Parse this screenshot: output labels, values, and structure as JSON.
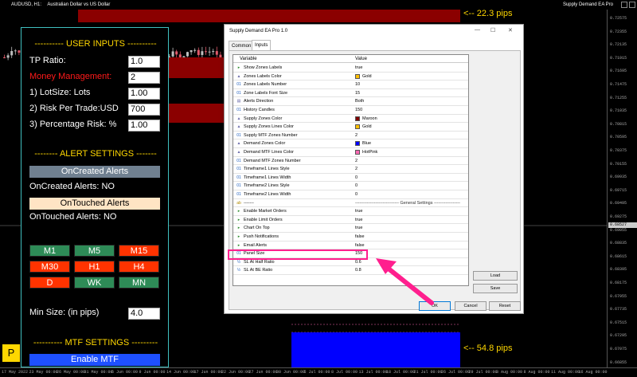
{
  "chart": {
    "symbol_text": "AUDUSD, H1:",
    "description": "Australian Dollar vs US Dollar",
    "ea_title": "Supply Demand EA Pro",
    "price_ticks": [
      "0.72575",
      "0.72355",
      "0.72135",
      "0.71915",
      "0.71695",
      "0.71475",
      "0.71255",
      "0.71035",
      "0.70815",
      "0.70595",
      "0.70375",
      "0.70155",
      "0.69935",
      "0.69715",
      "0.69495",
      "0.69275",
      "0.69055",
      "0.68835",
      "0.68615",
      "0.68395",
      "0.68175",
      "0.67955",
      "0.67735",
      "0.67515",
      "0.67295",
      "0.67075",
      "0.66855"
    ],
    "current_price": "0.68527",
    "time_ticks": [
      "17 May 2022",
      "23 May 00:00",
      "26 May 00:00",
      "31 May 00:00",
      "6 Jun 00:00",
      "9 Jun 00:00",
      "14 Jun 00:00",
      "17 Jun 00:00",
      "22 Jun 00:00",
      "27 Jun 00:00",
      "30 Jun 00:00",
      "5 Jul 00:00",
      "8 Jul 00:00",
      "13 Jul 00:00",
      "18 Jul 00:00",
      "21 Jul 00:00",
      "26 Jul 00:00",
      "29 Jul 00:00",
      "3 Aug 00:00",
      "8 Aug 00:00",
      "11 Aug 00:00",
      "16 Aug 00:00"
    ],
    "supply_pips": "<-- 22.3 pips",
    "demand_pips": "<-- 54.8 pips",
    "colors": {
      "supply": "#8b0000",
      "demand": "#0000ff",
      "bull": "#bfbfbf",
      "bear": "#e05a6a"
    }
  },
  "panel": {
    "user_inputs_title": "---------- USER INPUTS ----------",
    "tp_ratio_label": "TP Ratio:",
    "tp_ratio_value": "1.0",
    "money_mgmt_label": "Money Management:",
    "money_mgmt_value": "2",
    "lotsize_label": "1) LotSize: Lots",
    "lotsize_value": "1.00",
    "risk_label": "2) Risk Per Trade:USD",
    "risk_value": "700",
    "pct_label": "3) Percentage Risk: %",
    "pct_value": "1.00",
    "alert_title": "-------- ALERT SETTINGS -------",
    "oncreated_button": "OnCreated Alerts",
    "oncreated_status": "OnCreated Alerts: NO",
    "ontouched_button": "OnTouched Alerts",
    "ontouched_status": "OnTouched Alerts: NO",
    "timeframes": [
      {
        "label": "M1",
        "color": "green"
      },
      {
        "label": "M5",
        "color": "green"
      },
      {
        "label": "M15",
        "color": "red"
      },
      {
        "label": "M30",
        "color": "red"
      },
      {
        "label": "H1",
        "color": "red"
      },
      {
        "label": "H4",
        "color": "red"
      },
      {
        "label": "D",
        "color": "red"
      },
      {
        "label": "WK",
        "color": "green"
      },
      {
        "label": "MN",
        "color": "green"
      }
    ],
    "min_size_label": "Min Size: (in pips)",
    "min_size_value": "4.0",
    "mtf_title": "---------- MTF SETTINGS ---------",
    "enable_mtf_button": "Enable MTF",
    "p_button": "P"
  },
  "dialog": {
    "title": "Supply Demand EA Pro 1.0",
    "tabs": [
      "Common",
      "Inputs"
    ],
    "col_variable": "Variable",
    "col_value": "Value",
    "rows": [
      {
        "icon": "flag",
        "var": "Show Zones Labels",
        "val": "true"
      },
      {
        "icon": "color",
        "var": "Zones Labels Color",
        "val": "Gold",
        "swatch": "#ffc000"
      },
      {
        "icon": "int",
        "var": "Zones Labels Number",
        "val": "10"
      },
      {
        "icon": "int",
        "var": "Zone Labels Font Size",
        "val": "15"
      },
      {
        "icon": "enum",
        "var": "Alerts Direction",
        "val": "Both"
      },
      {
        "icon": "int",
        "var": "History Candles",
        "val": "150"
      },
      {
        "icon": "color",
        "var": "Supply Zones Color",
        "val": "Maroon",
        "swatch": "#800000"
      },
      {
        "icon": "color",
        "var": "Supply Zones Lines Color",
        "val": "Gold",
        "swatch": "#ffc000"
      },
      {
        "icon": "int",
        "var": "Supply MTF Zones Number",
        "val": "2"
      },
      {
        "icon": "color",
        "var": "Demand Zones Color",
        "val": "Blue",
        "swatch": "#0000ff"
      },
      {
        "icon": "color",
        "var": "Demand MTF Lines Color",
        "val": "HotPink",
        "swatch": "#ff69b4"
      },
      {
        "icon": "int",
        "var": "Demand MTF Zones Number",
        "val": "2"
      },
      {
        "icon": "int",
        "var": "Timeframe1 Lines Style",
        "val": "2"
      },
      {
        "icon": "int",
        "var": "Timeframe1 Lines Width",
        "val": "0"
      },
      {
        "icon": "int",
        "var": "Timeframe2 Lines Style",
        "val": "0"
      },
      {
        "icon": "int",
        "var": "Timeframe2 Lines Width",
        "val": "0"
      },
      {
        "icon": "str",
        "var": "-------",
        "val": "------------------------------ General Settings ------------------",
        "sep": true
      },
      {
        "icon": "flag",
        "var": "Enable Market Orders",
        "val": "true"
      },
      {
        "icon": "flag",
        "var": "Enable Limit Orders",
        "val": "true"
      },
      {
        "icon": "flag",
        "var": "Chart On Top",
        "val": "true"
      },
      {
        "icon": "flag",
        "var": "Push Notifications",
        "val": "false"
      },
      {
        "icon": "flag",
        "var": "Email Alerts",
        "val": "false"
      },
      {
        "icon": "int",
        "var": "Panel Size",
        "val": "150"
      },
      {
        "icon": "dbl",
        "var": "SL At Half Ratio",
        "val": "0.6"
      },
      {
        "icon": "dbl",
        "var": "SL At BE Ratio",
        "val": "0.8"
      }
    ],
    "load_button": "Load",
    "save_button": "Save",
    "ok_button": "OK",
    "cancel_button": "Cancel",
    "reset_button": "Reset",
    "highlight_color": "#ff1f8e"
  }
}
